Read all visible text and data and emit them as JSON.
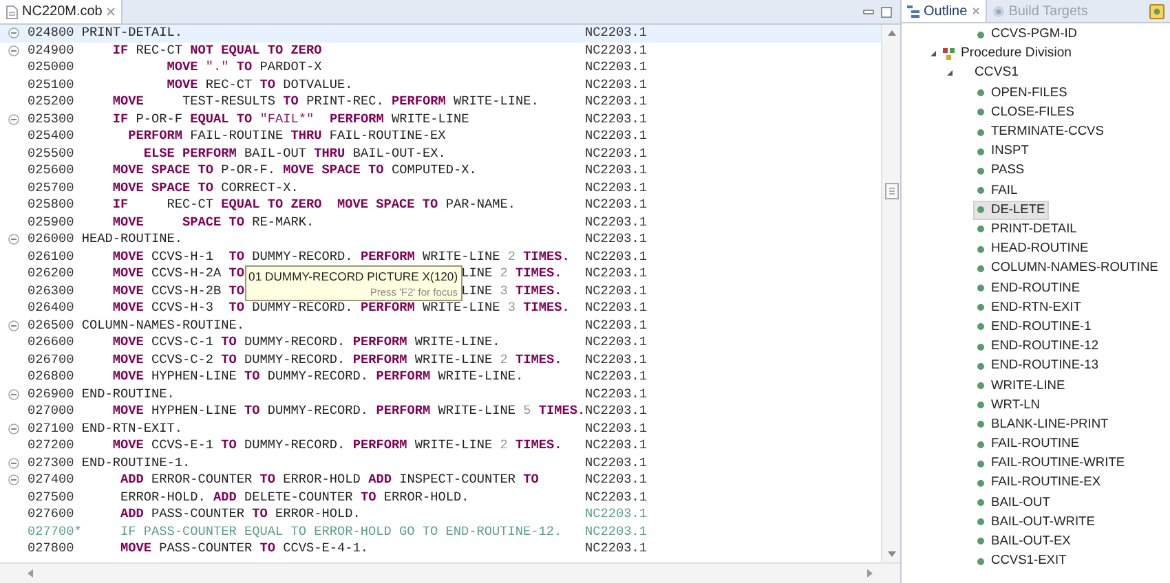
{
  "editor": {
    "tabs": [
      {
        "title": "NC220M.cob",
        "selected": true
      }
    ],
    "lines": [
      {
        "number": "024800",
        "foldable": true,
        "current": true,
        "comment": false,
        "tag_comment": false,
        "tag": "NC2203.1",
        "runs": [
          [
            {
              "kind": "text",
              "text": " PRINT-DETAIL."
            }
          ]
        ]
      },
      {
        "number": "024900",
        "foldable": true,
        "current": false,
        "comment": false,
        "tag_comment": false,
        "tag": "NC2203.1",
        "runs": [
          [
            {
              "kind": "keyword",
              "text": "     IF"
            },
            {
              "kind": "text",
              "text": " REC-CT "
            },
            {
              "kind": "keyword",
              "text": "NOT EQUAL TO ZERO"
            }
          ]
        ]
      },
      {
        "number": "025000",
        "foldable": false,
        "current": false,
        "comment": false,
        "tag_comment": false,
        "tag": "NC2203.1",
        "runs": [
          [
            {
              "kind": "keyword",
              "text": "            MOVE"
            },
            {
              "kind": "string",
              "text": " \".\""
            },
            {
              "kind": "keyword",
              "text": " TO"
            },
            {
              "kind": "text",
              "text": " PARDOT-X"
            }
          ]
        ]
      },
      {
        "number": "025100",
        "foldable": false,
        "current": false,
        "comment": false,
        "tag_comment": false,
        "tag": "NC2203.1",
        "runs": [
          [
            {
              "kind": "keyword",
              "text": "            MOVE"
            },
            {
              "kind": "text",
              "text": " REC-CT "
            },
            {
              "kind": "keyword",
              "text": "TO"
            },
            {
              "kind": "text",
              "text": " DOTVALUE."
            }
          ]
        ]
      },
      {
        "number": "025200",
        "foldable": false,
        "current": false,
        "comment": false,
        "tag_comment": false,
        "tag": "NC2203.1",
        "runs": [
          [
            {
              "kind": "keyword",
              "text": "     MOVE"
            },
            {
              "kind": "text",
              "text": "     TEST-RESULTS "
            },
            {
              "kind": "keyword",
              "text": "TO"
            },
            {
              "kind": "text",
              "text": " PRINT-REC. "
            },
            {
              "kind": "keyword",
              "text": "PERFORM"
            },
            {
              "kind": "text",
              "text": " WRITE-LINE."
            }
          ]
        ]
      },
      {
        "number": "025300",
        "foldable": true,
        "current": false,
        "comment": false,
        "tag_comment": false,
        "tag": "NC2203.1",
        "runs": [
          [
            {
              "kind": "keyword",
              "text": "     IF"
            },
            {
              "kind": "text",
              "text": " P-OR-F "
            },
            {
              "kind": "keyword",
              "text": "EQUAL TO"
            },
            {
              "kind": "string",
              "text": " \"FAIL*\""
            },
            {
              "kind": "keyword",
              "text": "  PERFORM"
            },
            {
              "kind": "text",
              "text": " WRITE-LINE"
            }
          ]
        ]
      },
      {
        "number": "025400",
        "foldable": false,
        "current": false,
        "comment": false,
        "tag_comment": false,
        "tag": "NC2203.1",
        "runs": [
          [
            {
              "kind": "keyword",
              "text": "       PERFORM"
            },
            {
              "kind": "text",
              "text": " FAIL-ROUTINE "
            },
            {
              "kind": "keyword",
              "text": "THRU"
            },
            {
              "kind": "text",
              "text": " FAIL-ROUTINE-EX"
            }
          ]
        ]
      },
      {
        "number": "025500",
        "foldable": false,
        "current": false,
        "comment": false,
        "tag_comment": false,
        "tag": "NC2203.1",
        "runs": [
          [
            {
              "kind": "keyword",
              "text": "         ELSE PERFORM"
            },
            {
              "kind": "text",
              "text": " BAIL-OUT "
            },
            {
              "kind": "keyword",
              "text": "THRU"
            },
            {
              "kind": "text",
              "text": " BAIL-OUT-EX."
            }
          ]
        ]
      },
      {
        "number": "025600",
        "foldable": false,
        "current": false,
        "comment": false,
        "tag_comment": false,
        "tag": "NC2203.1",
        "runs": [
          [
            {
              "kind": "keyword",
              "text": "     MOVE SPACE TO"
            },
            {
              "kind": "text",
              "text": " P-OR-F. "
            },
            {
              "kind": "keyword",
              "text": "MOVE SPACE TO"
            },
            {
              "kind": "text",
              "text": " COMPUTED-X."
            }
          ]
        ]
      },
      {
        "number": "025700",
        "foldable": false,
        "current": false,
        "comment": false,
        "tag_comment": false,
        "tag": "NC2203.1",
        "runs": [
          [
            {
              "kind": "keyword",
              "text": "     MOVE SPACE TO"
            },
            {
              "kind": "text",
              "text": " CORRECT-X."
            }
          ]
        ]
      },
      {
        "number": "025800",
        "foldable": false,
        "current": false,
        "comment": false,
        "tag_comment": false,
        "tag": "NC2203.1",
        "runs": [
          [
            {
              "kind": "keyword",
              "text": "     IF"
            },
            {
              "kind": "text",
              "text": "     REC-CT "
            },
            {
              "kind": "keyword",
              "text": "EQUAL TO ZERO  MOVE SPACE TO"
            },
            {
              "kind": "text",
              "text": " PAR-NAME."
            }
          ]
        ]
      },
      {
        "number": "025900",
        "foldable": false,
        "current": false,
        "comment": false,
        "tag_comment": false,
        "tag": "NC2203.1",
        "runs": [
          [
            {
              "kind": "keyword",
              "text": "     MOVE     SPACE TO"
            },
            {
              "kind": "text",
              "text": " RE-MARK."
            }
          ]
        ]
      },
      {
        "number": "026000",
        "foldable": true,
        "current": false,
        "comment": false,
        "tag_comment": false,
        "tag": "NC2203.1",
        "runs": [
          [
            {
              "kind": "text",
              "text": " HEAD-ROUTINE."
            }
          ]
        ]
      },
      {
        "number": "026100",
        "foldable": false,
        "current": false,
        "comment": false,
        "tag_comment": false,
        "tag": "NC2203.1",
        "runs": [
          [
            {
              "kind": "keyword",
              "text": "     MOVE"
            },
            {
              "kind": "text",
              "text": " CCVS-H-1  "
            },
            {
              "kind": "keyword",
              "text": "TO"
            },
            {
              "kind": "text",
              "text": " DUMMY-RECORD. "
            },
            {
              "kind": "keyword",
              "text": "PERFORM"
            },
            {
              "kind": "text",
              "text": " WRITE-LINE "
            },
            {
              "kind": "number",
              "text": "2"
            },
            {
              "kind": "keyword",
              "text": " TIMES."
            }
          ]
        ]
      },
      {
        "number": "026200",
        "foldable": false,
        "current": false,
        "comment": false,
        "tag_comment": false,
        "tag": "NC2203.1",
        "tooltip": {
          "text": "01 DUMMY-RECORD PICTURE X(120)",
          "hint": "Press 'F2' for focus"
        },
        "runs": [
          [
            {
              "kind": "keyword",
              "text": "     MOVE"
            },
            {
              "kind": "text",
              "text": " CCVS-H-2A "
            },
            {
              "kind": "keyword",
              "text": "TO"
            }
          ],
          [
            {
              "kind": "text",
              "text": "LINE "
            },
            {
              "kind": "number",
              "text": "2"
            },
            {
              "kind": "keyword",
              "text": " TIMES."
            }
          ]
        ]
      },
      {
        "number": "026300",
        "foldable": false,
        "current": false,
        "comment": false,
        "tag_comment": false,
        "tag": "NC2203.1",
        "runs": [
          [
            {
              "kind": "keyword",
              "text": "     MOVE"
            },
            {
              "kind": "text",
              "text": " CCVS-H-2B "
            },
            {
              "kind": "keyword",
              "text": "TO"
            }
          ],
          [
            {
              "kind": "text",
              "text": "LINE "
            },
            {
              "kind": "number",
              "text": "3"
            },
            {
              "kind": "keyword",
              "text": " TIMES."
            }
          ]
        ]
      },
      {
        "number": "026400",
        "foldable": false,
        "current": false,
        "comment": false,
        "tag_comment": false,
        "tag": "NC2203.1",
        "runs": [
          [
            {
              "kind": "keyword",
              "text": "     MOVE"
            },
            {
              "kind": "text",
              "text": " CCVS-H-3  "
            },
            {
              "kind": "keyword",
              "text": "TO"
            },
            {
              "kind": "text",
              "text": " DUMMY-RECORD. "
            },
            {
              "kind": "keyword",
              "text": "PERFORM"
            },
            {
              "kind": "text",
              "text": " WRITE-LINE "
            },
            {
              "kind": "number",
              "text": "3"
            },
            {
              "kind": "keyword",
              "text": " TIMES."
            }
          ]
        ]
      },
      {
        "number": "026500",
        "foldable": true,
        "current": false,
        "comment": false,
        "tag_comment": false,
        "tag": "NC2203.1",
        "runs": [
          [
            {
              "kind": "text",
              "text": " COLUMN-NAMES-ROUTINE."
            }
          ]
        ]
      },
      {
        "number": "026600",
        "foldable": false,
        "current": false,
        "comment": false,
        "tag_comment": false,
        "tag": "NC2203.1",
        "runs": [
          [
            {
              "kind": "keyword",
              "text": "     MOVE"
            },
            {
              "kind": "text",
              "text": " CCVS-C-1 "
            },
            {
              "kind": "keyword",
              "text": "TO"
            },
            {
              "kind": "text",
              "text": " DUMMY-RECORD. "
            },
            {
              "kind": "keyword",
              "text": "PERFORM"
            },
            {
              "kind": "text",
              "text": " WRITE-LINE."
            }
          ]
        ]
      },
      {
        "number": "026700",
        "foldable": false,
        "current": false,
        "comment": false,
        "tag_comment": false,
        "tag": "NC2203.1",
        "runs": [
          [
            {
              "kind": "keyword",
              "text": "     MOVE"
            },
            {
              "kind": "text",
              "text": " CCVS-C-2 "
            },
            {
              "kind": "keyword",
              "text": "TO"
            },
            {
              "kind": "text",
              "text": " DUMMY-RECORD. "
            },
            {
              "kind": "keyword",
              "text": "PERFORM"
            },
            {
              "kind": "text",
              "text": " WRITE-LINE "
            },
            {
              "kind": "number",
              "text": "2"
            },
            {
              "kind": "keyword",
              "text": " TIMES."
            }
          ]
        ]
      },
      {
        "number": "026800",
        "foldable": false,
        "current": false,
        "comment": false,
        "tag_comment": false,
        "tag": "NC2203.1",
        "runs": [
          [
            {
              "kind": "keyword",
              "text": "     MOVE"
            },
            {
              "kind": "text",
              "text": " HYPHEN-LINE "
            },
            {
              "kind": "keyword",
              "text": "TO"
            },
            {
              "kind": "text",
              "text": " DUMMY-RECORD. "
            },
            {
              "kind": "keyword",
              "text": "PERFORM"
            },
            {
              "kind": "text",
              "text": " WRITE-LINE."
            }
          ]
        ]
      },
      {
        "number": "026900",
        "foldable": true,
        "current": false,
        "comment": false,
        "tag_comment": false,
        "tag": "NC2203.1",
        "runs": [
          [
            {
              "kind": "text",
              "text": " END-ROUTINE."
            }
          ]
        ]
      },
      {
        "number": "027000",
        "foldable": false,
        "current": false,
        "comment": false,
        "tag_comment": false,
        "tag": "NC2203.1",
        "runs": [
          [
            {
              "kind": "keyword",
              "text": "     MOVE"
            },
            {
              "kind": "text",
              "text": " HYPHEN-LINE "
            },
            {
              "kind": "keyword",
              "text": "TO"
            },
            {
              "kind": "text",
              "text": " DUMMY-RECORD. "
            },
            {
              "kind": "keyword",
              "text": "PERFORM"
            },
            {
              "kind": "text",
              "text": " WRITE-LINE "
            },
            {
              "kind": "number",
              "text": "5"
            },
            {
              "kind": "keyword",
              "text": " TIMES."
            }
          ]
        ]
      },
      {
        "number": "027100",
        "foldable": true,
        "current": false,
        "comment": false,
        "tag_comment": false,
        "tag": "NC2203.1",
        "runs": [
          [
            {
              "kind": "text",
              "text": " END-RTN-EXIT."
            }
          ]
        ]
      },
      {
        "number": "027200",
        "foldable": false,
        "current": false,
        "comment": false,
        "tag_comment": false,
        "tag": "NC2203.1",
        "runs": [
          [
            {
              "kind": "keyword",
              "text": "     MOVE"
            },
            {
              "kind": "text",
              "text": " CCVS-E-1 "
            },
            {
              "kind": "keyword",
              "text": "TO"
            },
            {
              "kind": "text",
              "text": " DUMMY-RECORD. "
            },
            {
              "kind": "keyword",
              "text": "PERFORM"
            },
            {
              "kind": "text",
              "text": " WRITE-LINE "
            },
            {
              "kind": "number",
              "text": "2"
            },
            {
              "kind": "keyword",
              "text": " TIMES."
            }
          ]
        ]
      },
      {
        "number": "027300",
        "foldable": true,
        "current": false,
        "comment": false,
        "tag_comment": false,
        "tag": "NC2203.1",
        "runs": [
          [
            {
              "kind": "text",
              "text": " END-ROUTINE-1."
            }
          ]
        ]
      },
      {
        "number": "027400",
        "foldable": true,
        "current": false,
        "comment": false,
        "tag_comment": false,
        "tag": "NC2203.1",
        "runs": [
          [
            {
              "kind": "keyword",
              "text": "      ADD"
            },
            {
              "kind": "text",
              "text": " ERROR-COUNTER "
            },
            {
              "kind": "keyword",
              "text": "TO"
            },
            {
              "kind": "text",
              "text": " ERROR-HOLD "
            },
            {
              "kind": "keyword",
              "text": "ADD"
            },
            {
              "kind": "text",
              "text": " INSPECT-COUNTER "
            },
            {
              "kind": "keyword",
              "text": "TO"
            }
          ]
        ]
      },
      {
        "number": "027500",
        "foldable": false,
        "current": false,
        "comment": false,
        "tag_comment": false,
        "tag": "NC2203.1",
        "runs": [
          [
            {
              "kind": "text",
              "text": "      ERROR-HOLD. "
            },
            {
              "kind": "keyword",
              "text": "ADD"
            },
            {
              "kind": "text",
              "text": " DELETE-COUNTER "
            },
            {
              "kind": "keyword",
              "text": "TO"
            },
            {
              "kind": "text",
              "text": " ERROR-HOLD."
            }
          ]
        ]
      },
      {
        "number": "027600",
        "foldable": false,
        "current": false,
        "comment": false,
        "tag_comment": true,
        "tag": "NC2203.1",
        "runs": [
          [
            {
              "kind": "keyword",
              "text": "      ADD"
            },
            {
              "kind": "text",
              "text": " PASS-COUNTER "
            },
            {
              "kind": "keyword",
              "text": "TO"
            },
            {
              "kind": "text",
              "text": " ERROR-HOLD."
            }
          ]
        ]
      },
      {
        "number": "027700",
        "foldable": false,
        "current": false,
        "comment": true,
        "tag_comment": true,
        "tag": "NC2203.1",
        "runs": [
          [
            {
              "kind": "text",
              "text": "*     IF PASS-COUNTER EQUAL TO ERROR-HOLD GO TO END-ROUTINE-12."
            }
          ]
        ]
      },
      {
        "number": "027800",
        "foldable": false,
        "current": false,
        "comment": false,
        "tag_comment": false,
        "tag": "NC2203.1",
        "runs": [
          [
            {
              "kind": "keyword",
              "text": "      MOVE"
            },
            {
              "kind": "text",
              "text": " PASS-COUNTER "
            },
            {
              "kind": "keyword",
              "text": "TO"
            },
            {
              "kind": "text",
              "text": " CCVS-E-4-1."
            }
          ]
        ]
      }
    ]
  },
  "outline": {
    "tabs": [
      {
        "label": "Outline",
        "selected": true
      },
      {
        "label": "Build Targets",
        "selected": false
      }
    ],
    "continued_item": {
      "label": "CCVS-PGM-ID"
    },
    "tree": [
      {
        "label": "Procedure Division",
        "expanded": true,
        "children": [
          {
            "label": "CCVS1",
            "expanded": true,
            "children": [
              {
                "label": "OPEN-FILES",
                "selected": false
              },
              {
                "label": "CLOSE-FILES",
                "selected": false
              },
              {
                "label": "TERMINATE-CCVS",
                "selected": false
              },
              {
                "label": "INSPT",
                "selected": false
              },
              {
                "label": "PASS",
                "selected": false
              },
              {
                "label": "FAIL",
                "selected": false
              },
              {
                "label": "DE-LETE",
                "selected": true
              },
              {
                "label": "PRINT-DETAIL",
                "selected": false
              },
              {
                "label": "HEAD-ROUTINE",
                "selected": false
              },
              {
                "label": "COLUMN-NAMES-ROUTINE",
                "selected": false
              },
              {
                "label": "END-ROUTINE",
                "selected": false
              },
              {
                "label": "END-RTN-EXIT",
                "selected": false
              },
              {
                "label": "END-ROUTINE-1",
                "selected": false
              },
              {
                "label": "END-ROUTINE-12",
                "selected": false
              },
              {
                "label": "END-ROUTINE-13",
                "selected": false
              },
              {
                "label": "WRITE-LINE",
                "selected": false
              },
              {
                "label": "WRT-LN",
                "selected": false
              },
              {
                "label": "BLANK-LINE-PRINT",
                "selected": false
              },
              {
                "label": "FAIL-ROUTINE",
                "selected": false
              },
              {
                "label": "FAIL-ROUTINE-WRITE",
                "selected": false
              },
              {
                "label": "FAIL-ROUTINE-EX",
                "selected": false
              },
              {
                "label": "BAIL-OUT",
                "selected": false
              },
              {
                "label": "BAIL-OUT-WRITE",
                "selected": false
              },
              {
                "label": "BAIL-OUT-EX",
                "selected": false
              },
              {
                "label": "CCVS1-EXIT",
                "selected": false
              }
            ]
          }
        ]
      }
    ]
  }
}
